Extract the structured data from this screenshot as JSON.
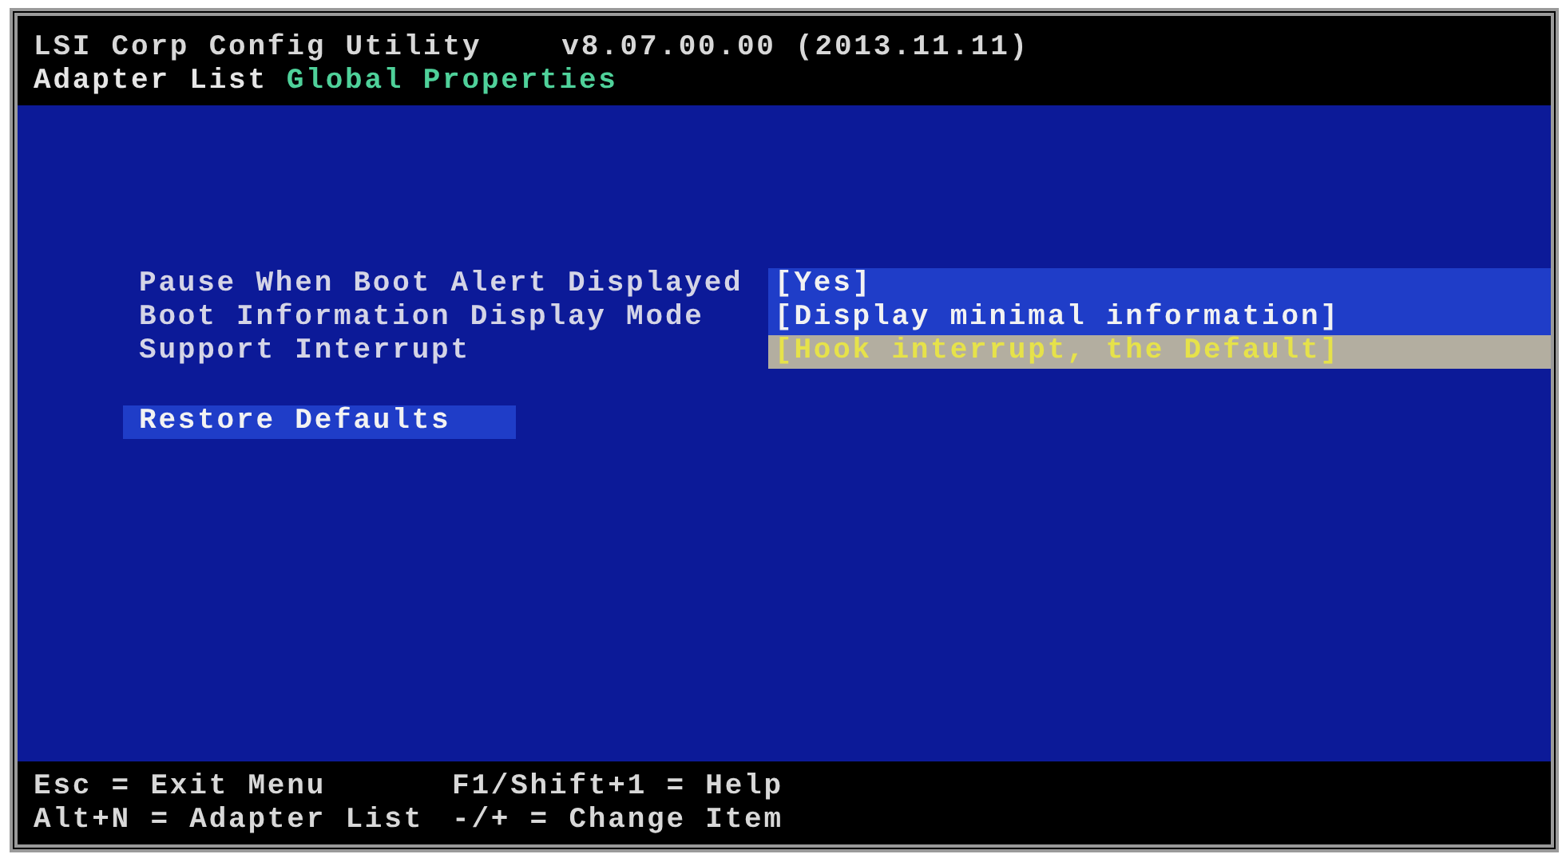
{
  "header": {
    "title": "LSI Corp Config Utility",
    "version": "v8.07.00.00 (2013.11.11)"
  },
  "tabs": [
    {
      "label": "Adapter List",
      "selected": false
    },
    {
      "label": "Global Properties",
      "selected": true
    }
  ],
  "settings": [
    {
      "label": "Pause When Boot Alert Displayed",
      "value": "[Yes]",
      "selected": false
    },
    {
      "label": "Boot Information Display Mode",
      "value": "[Display minimal information]",
      "selected": false
    },
    {
      "label": "Support Interrupt",
      "value": "[Hook interrupt, the Default]",
      "selected": true
    }
  ],
  "actions": [
    {
      "label": "Restore Defaults",
      "selected": false
    }
  ],
  "footer": [
    [
      "Esc = Exit Menu",
      "F1/Shift+1 = Help"
    ],
    [
      "Alt+N = Adapter List",
      "-/+ = Change Item"
    ]
  ]
}
